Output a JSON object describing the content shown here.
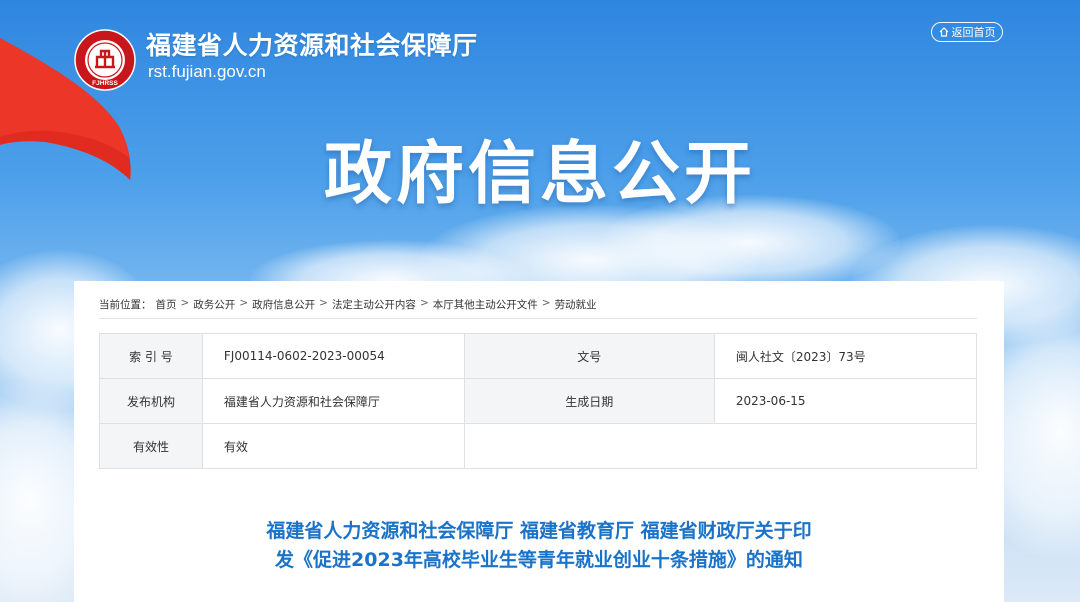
{
  "header": {
    "site_title": "福建省人力资源和社会保障厅",
    "site_url": "rst.fujian.gov.cn",
    "home_button": "返回首页",
    "logo_letters": "FJHRSS"
  },
  "banner": {
    "title": "政府信息公开"
  },
  "breadcrumb": {
    "prefix": "当前位置：",
    "items": [
      "首页",
      "政务公开",
      "政府信息公开",
      "法定主动公开内容",
      "本厅其他主动公开文件",
      "劳动就业"
    ],
    "separator": ">"
  },
  "meta": {
    "index_label": "索 引 号",
    "index_value": "FJ00114-0602-2023-00054",
    "docno_label": "文号",
    "docno_value": "闽人社文〔2023〕73号",
    "issuer_label": "发布机构",
    "issuer_value": "福建省人力资源和社会保障厅",
    "date_label": "生成日期",
    "date_value": "2023-06-15",
    "validity_label": "有效性",
    "validity_value": "有效"
  },
  "document": {
    "title_line1": "福建省人力资源和社会保障厅 福建省教育厅 福建省财政厅关于印",
    "title_line2": "发《促进2023年高校毕业生等青年就业创业十条措施》的通知"
  },
  "colors": {
    "sky_top": "#2f86df",
    "flag_red": "#e12b20",
    "title_blue": "#1a73c9",
    "label_bg": "#f4f5f7"
  }
}
